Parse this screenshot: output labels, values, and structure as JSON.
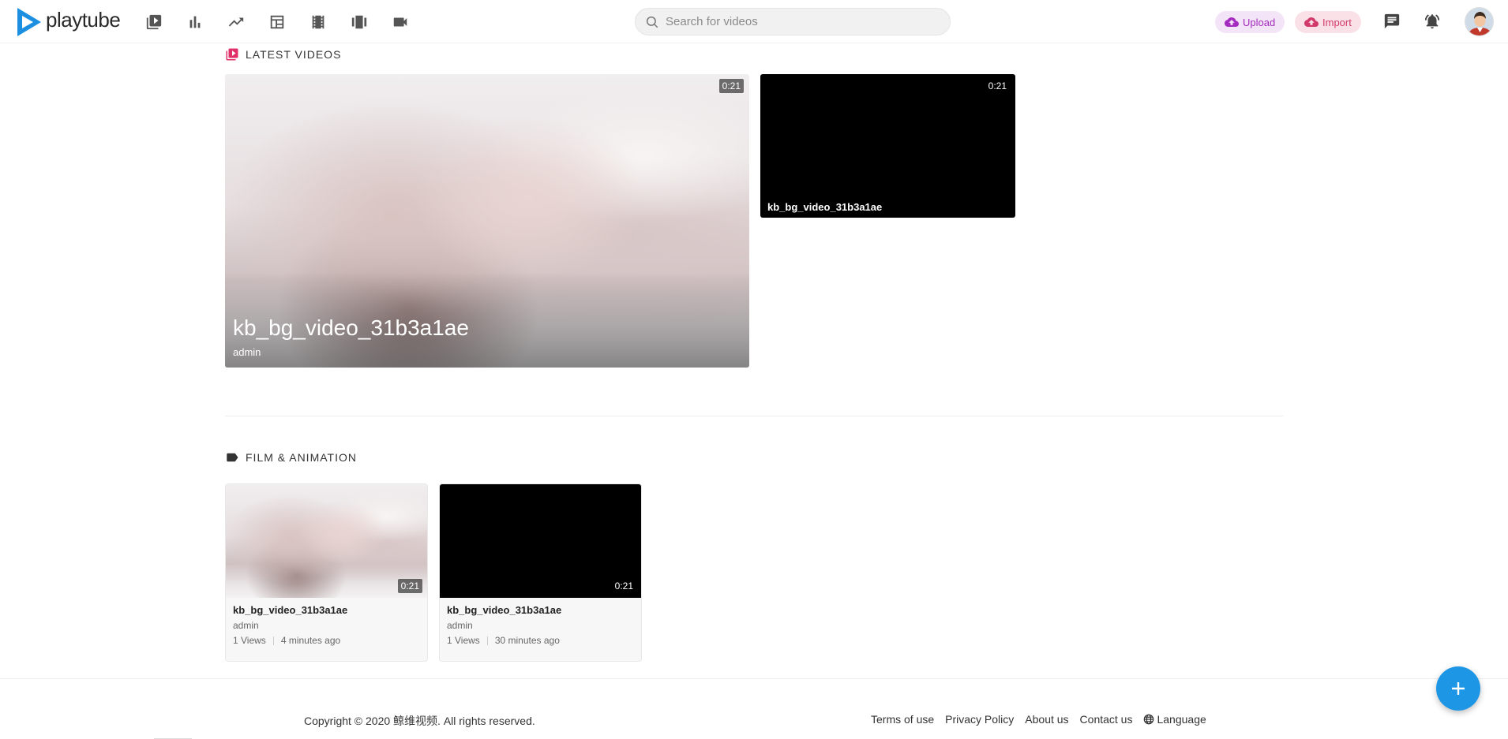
{
  "header": {
    "logo_text": "playtube",
    "search_placeholder": "Search for videos",
    "upload_label": "Upload",
    "import_label": "Import",
    "nav_icons": [
      "videos-icon",
      "chart-bar-icon",
      "trending-icon",
      "calendar-icon",
      "film-strip-icon",
      "carousel-icon",
      "video-camera-icon"
    ]
  },
  "latest": {
    "title": "LATEST VIDEOS",
    "hero": {
      "title": "kb_bg_video_31b3a1ae",
      "author": "admin",
      "duration": "0:21"
    },
    "side": {
      "title": "kb_bg_video_31b3a1ae",
      "duration": "0:21"
    }
  },
  "film": {
    "title": "FILM & ANIMATION",
    "cards": [
      {
        "title": "kb_bg_video_31b3a1ae",
        "author": "admin",
        "views": "1 Views",
        "time": "4 minutes ago",
        "duration": "0:21"
      },
      {
        "title": "kb_bg_video_31b3a1ae",
        "author": "admin",
        "views": "1 Views",
        "time": "30 minutes ago",
        "duration": "0:21"
      }
    ]
  },
  "footer": {
    "copyright": "Copyright © 2020 鲸维视频. All rights reserved.",
    "links": {
      "terms": "Terms of use",
      "privacy": "Privacy Policy",
      "about": "About us",
      "contact": "Contact us",
      "language": "Language"
    }
  },
  "colors": {
    "accent": "#1e96e6",
    "upload": "#a32bbf",
    "import": "#d23a6c",
    "section_icon": "#e0306a"
  }
}
